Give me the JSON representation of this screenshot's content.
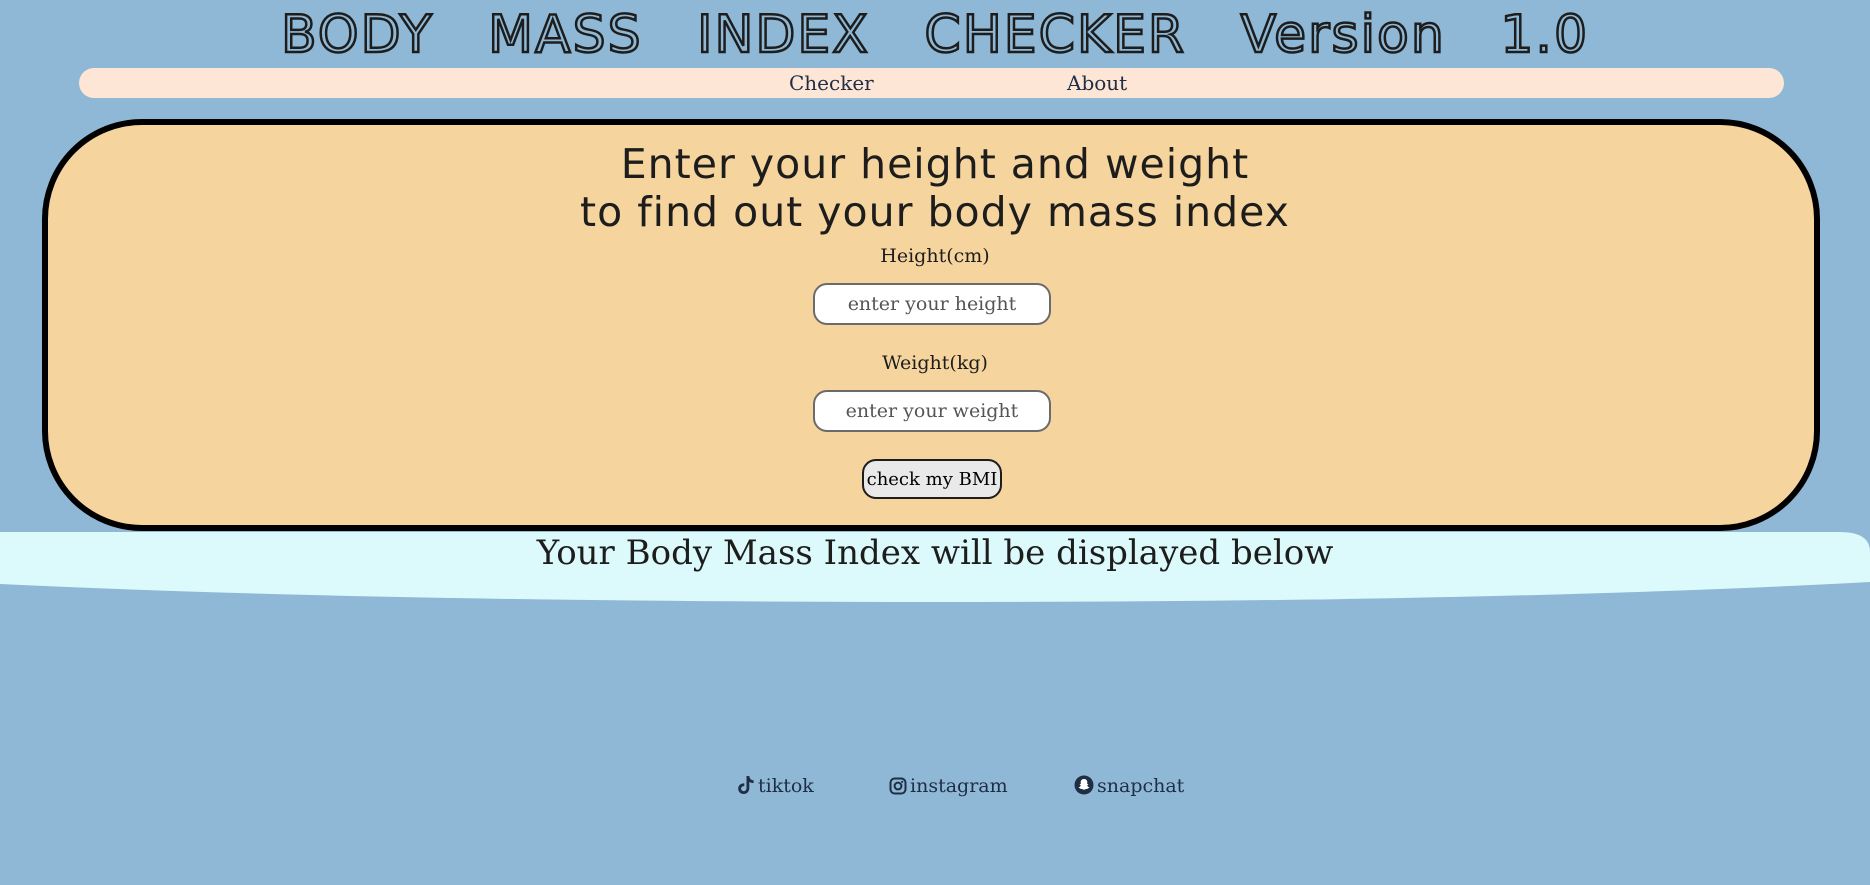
{
  "header": {
    "title": "BODY MASS INDEX CHECKER Version 1.0"
  },
  "nav": {
    "items": [
      {
        "label": "Checker"
      },
      {
        "label": "About"
      }
    ]
  },
  "form": {
    "headline_line1": "Enter your height and weight",
    "headline_line2": "to find out your body mass index",
    "height_label": "Height(cm)",
    "height_placeholder": "enter your height",
    "height_value": "",
    "weight_label": "Weight(kg)",
    "weight_placeholder": "enter your weight",
    "weight_value": "",
    "submit_label": "check my BMI"
  },
  "result": {
    "text": "Your Body Mass Index will be displayed below"
  },
  "socials": [
    {
      "label": "tiktok",
      "icon": "tiktok-icon"
    },
    {
      "label": "instagram",
      "icon": "instagram-icon"
    },
    {
      "label": "snapchat",
      "icon": "snapchat-icon"
    }
  ],
  "colors": {
    "page_background": "#8eb8d5",
    "nav_background": "#fde6d6",
    "card_background": "#f6d49d",
    "card_border": "#000000",
    "result_banner": "#dcfafb",
    "link_text": "#1f2d45"
  }
}
